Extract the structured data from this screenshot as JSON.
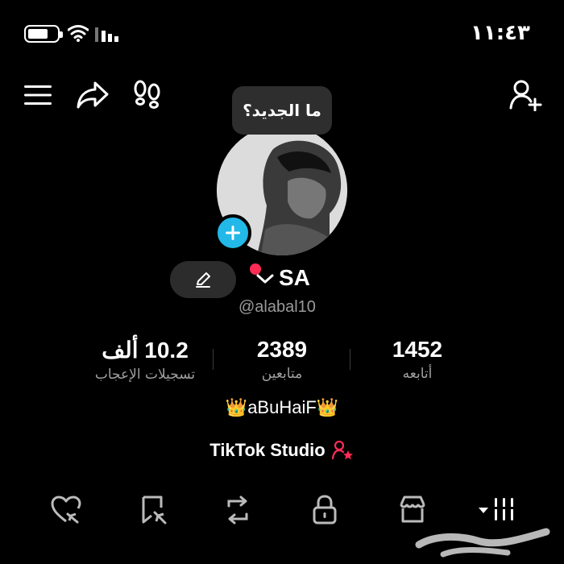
{
  "status_bar": {
    "time": "١١:٤٣",
    "icons": [
      "battery-icon",
      "wifi-icon",
      "signal-icon"
    ]
  },
  "top_bar": {
    "icons": [
      "menu-icon",
      "share-icon",
      "footprints-icon",
      "add-friend-icon"
    ]
  },
  "tooltip": {
    "text": "ما الجديد؟"
  },
  "profile": {
    "display_name": "SA",
    "username": "@alabal10",
    "bio": "👑aBuHaiF👑",
    "studio_label": "TikTok Studio"
  },
  "stats": {
    "likes": {
      "value": "10.2 ألف",
      "label": "تسجيلات الإعجاب"
    },
    "followers": {
      "value": "2389",
      "label": "متابعين"
    },
    "following": {
      "value": "1452",
      "label": "أتابعه"
    }
  },
  "tabs": {
    "icons": [
      "liked-videos-icon",
      "favorites-icon",
      "reposts-icon",
      "private-lock-icon",
      "shop-icon",
      "videos-grid-icon"
    ]
  },
  "colors": {
    "background": "#000000",
    "accent_blue": "#22b8e8",
    "accent_red": "#fe2c55",
    "muted_text": "#9a9a9a"
  }
}
